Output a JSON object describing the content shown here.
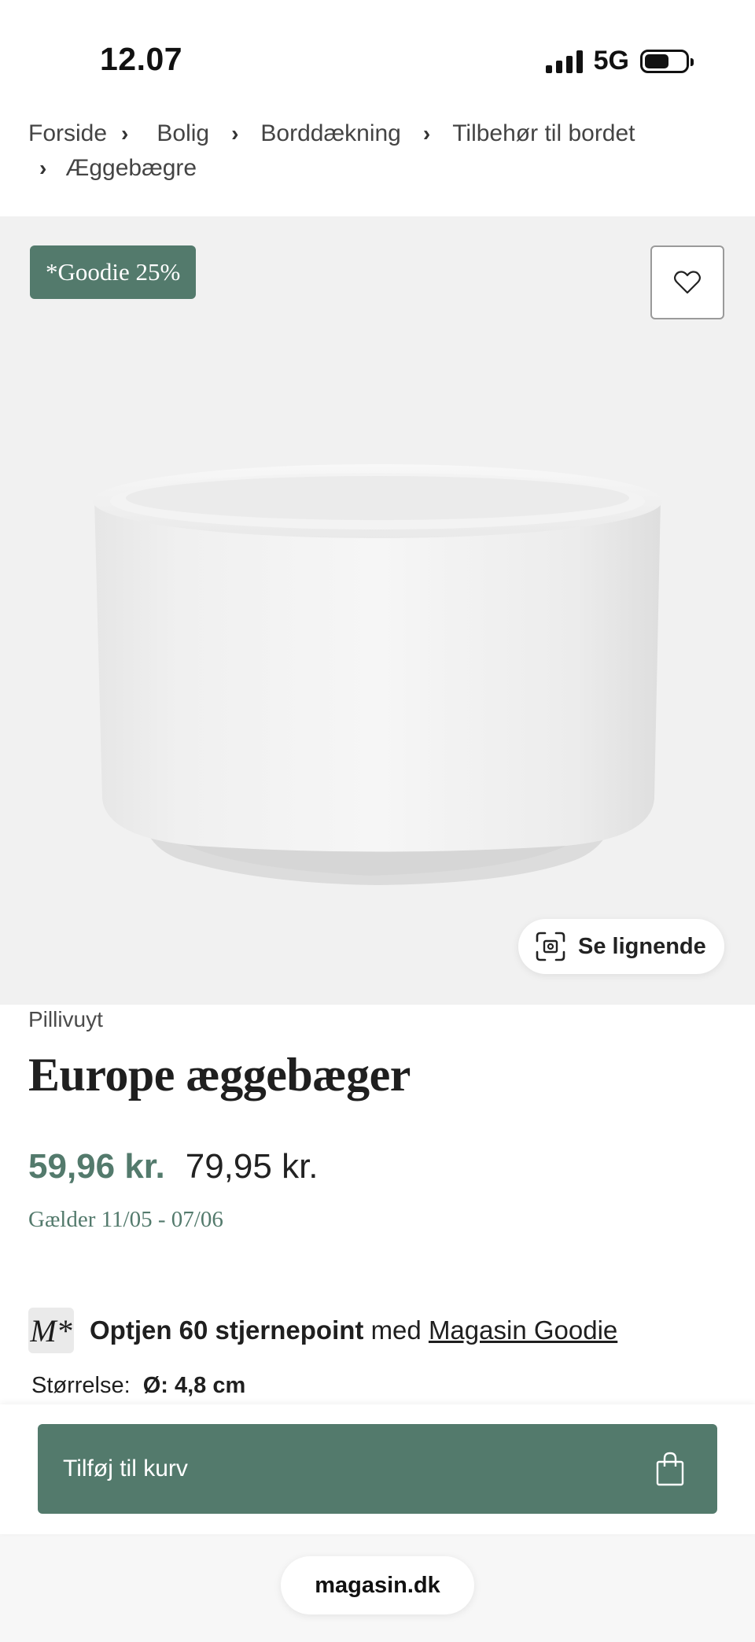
{
  "status_bar": {
    "time": "12.07",
    "network": "5G",
    "battery_level": 0.6
  },
  "breadcrumb": {
    "items": [
      "Forside",
      "Bolig",
      "Borddækning",
      "Tilbehør til bordet",
      "Æggebægre"
    ]
  },
  "hero": {
    "badge": "*Goodie 25%",
    "favorite_icon": "heart-icon",
    "similar_label": "Se lignende",
    "similar_icon": "visual-search-icon"
  },
  "product": {
    "brand": "Pillivuyt",
    "title": "Europe æggebæger",
    "price_sale": "59,96 kr.",
    "price_original": "79,95 kr.",
    "validity": "Gælder 11/05 - 07/06"
  },
  "loyalty": {
    "logo_text": "M*",
    "points_text": "Optjen 60 stjernepoint",
    "connector": "med",
    "program_link": "Magasin Goodie"
  },
  "size": {
    "label": "Størrelse:",
    "value": "Ø: 4,8 cm"
  },
  "cart": {
    "button_label": "Tilføj til kurv",
    "icon": "shopping-bag-icon"
  },
  "browser": {
    "url": "magasin.dk"
  },
  "colors": {
    "accent_green": "#537a6c",
    "hero_background": "#f1f1f1"
  }
}
